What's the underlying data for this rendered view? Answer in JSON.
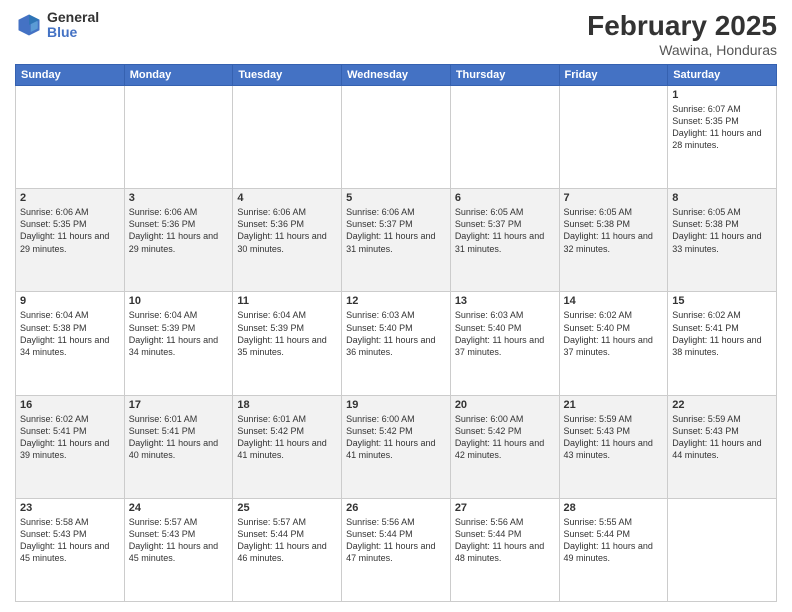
{
  "header": {
    "logo_general": "General",
    "logo_blue": "Blue",
    "month_title": "February 2025",
    "location": "Wawina, Honduras"
  },
  "days_of_week": [
    "Sunday",
    "Monday",
    "Tuesday",
    "Wednesday",
    "Thursday",
    "Friday",
    "Saturday"
  ],
  "weeks": [
    [
      {
        "day": "",
        "info": ""
      },
      {
        "day": "",
        "info": ""
      },
      {
        "day": "",
        "info": ""
      },
      {
        "day": "",
        "info": ""
      },
      {
        "day": "",
        "info": ""
      },
      {
        "day": "",
        "info": ""
      },
      {
        "day": "1",
        "info": "Sunrise: 6:07 AM\nSunset: 5:35 PM\nDaylight: 11 hours and 28 minutes."
      }
    ],
    [
      {
        "day": "2",
        "info": "Sunrise: 6:06 AM\nSunset: 5:35 PM\nDaylight: 11 hours and 29 minutes."
      },
      {
        "day": "3",
        "info": "Sunrise: 6:06 AM\nSunset: 5:36 PM\nDaylight: 11 hours and 29 minutes."
      },
      {
        "day": "4",
        "info": "Sunrise: 6:06 AM\nSunset: 5:36 PM\nDaylight: 11 hours and 30 minutes."
      },
      {
        "day": "5",
        "info": "Sunrise: 6:06 AM\nSunset: 5:37 PM\nDaylight: 11 hours and 31 minutes."
      },
      {
        "day": "6",
        "info": "Sunrise: 6:05 AM\nSunset: 5:37 PM\nDaylight: 11 hours and 31 minutes."
      },
      {
        "day": "7",
        "info": "Sunrise: 6:05 AM\nSunset: 5:38 PM\nDaylight: 11 hours and 32 minutes."
      },
      {
        "day": "8",
        "info": "Sunrise: 6:05 AM\nSunset: 5:38 PM\nDaylight: 11 hours and 33 minutes."
      }
    ],
    [
      {
        "day": "9",
        "info": "Sunrise: 6:04 AM\nSunset: 5:38 PM\nDaylight: 11 hours and 34 minutes."
      },
      {
        "day": "10",
        "info": "Sunrise: 6:04 AM\nSunset: 5:39 PM\nDaylight: 11 hours and 34 minutes."
      },
      {
        "day": "11",
        "info": "Sunrise: 6:04 AM\nSunset: 5:39 PM\nDaylight: 11 hours and 35 minutes."
      },
      {
        "day": "12",
        "info": "Sunrise: 6:03 AM\nSunset: 5:40 PM\nDaylight: 11 hours and 36 minutes."
      },
      {
        "day": "13",
        "info": "Sunrise: 6:03 AM\nSunset: 5:40 PM\nDaylight: 11 hours and 37 minutes."
      },
      {
        "day": "14",
        "info": "Sunrise: 6:02 AM\nSunset: 5:40 PM\nDaylight: 11 hours and 37 minutes."
      },
      {
        "day": "15",
        "info": "Sunrise: 6:02 AM\nSunset: 5:41 PM\nDaylight: 11 hours and 38 minutes."
      }
    ],
    [
      {
        "day": "16",
        "info": "Sunrise: 6:02 AM\nSunset: 5:41 PM\nDaylight: 11 hours and 39 minutes."
      },
      {
        "day": "17",
        "info": "Sunrise: 6:01 AM\nSunset: 5:41 PM\nDaylight: 11 hours and 40 minutes."
      },
      {
        "day": "18",
        "info": "Sunrise: 6:01 AM\nSunset: 5:42 PM\nDaylight: 11 hours and 41 minutes."
      },
      {
        "day": "19",
        "info": "Sunrise: 6:00 AM\nSunset: 5:42 PM\nDaylight: 11 hours and 41 minutes."
      },
      {
        "day": "20",
        "info": "Sunrise: 6:00 AM\nSunset: 5:42 PM\nDaylight: 11 hours and 42 minutes."
      },
      {
        "day": "21",
        "info": "Sunrise: 5:59 AM\nSunset: 5:43 PM\nDaylight: 11 hours and 43 minutes."
      },
      {
        "day": "22",
        "info": "Sunrise: 5:59 AM\nSunset: 5:43 PM\nDaylight: 11 hours and 44 minutes."
      }
    ],
    [
      {
        "day": "23",
        "info": "Sunrise: 5:58 AM\nSunset: 5:43 PM\nDaylight: 11 hours and 45 minutes."
      },
      {
        "day": "24",
        "info": "Sunrise: 5:57 AM\nSunset: 5:43 PM\nDaylight: 11 hours and 45 minutes."
      },
      {
        "day": "25",
        "info": "Sunrise: 5:57 AM\nSunset: 5:44 PM\nDaylight: 11 hours and 46 minutes."
      },
      {
        "day": "26",
        "info": "Sunrise: 5:56 AM\nSunset: 5:44 PM\nDaylight: 11 hours and 47 minutes."
      },
      {
        "day": "27",
        "info": "Sunrise: 5:56 AM\nSunset: 5:44 PM\nDaylight: 11 hours and 48 minutes."
      },
      {
        "day": "28",
        "info": "Sunrise: 5:55 AM\nSunset: 5:44 PM\nDaylight: 11 hours and 49 minutes."
      },
      {
        "day": "",
        "info": ""
      }
    ]
  ]
}
